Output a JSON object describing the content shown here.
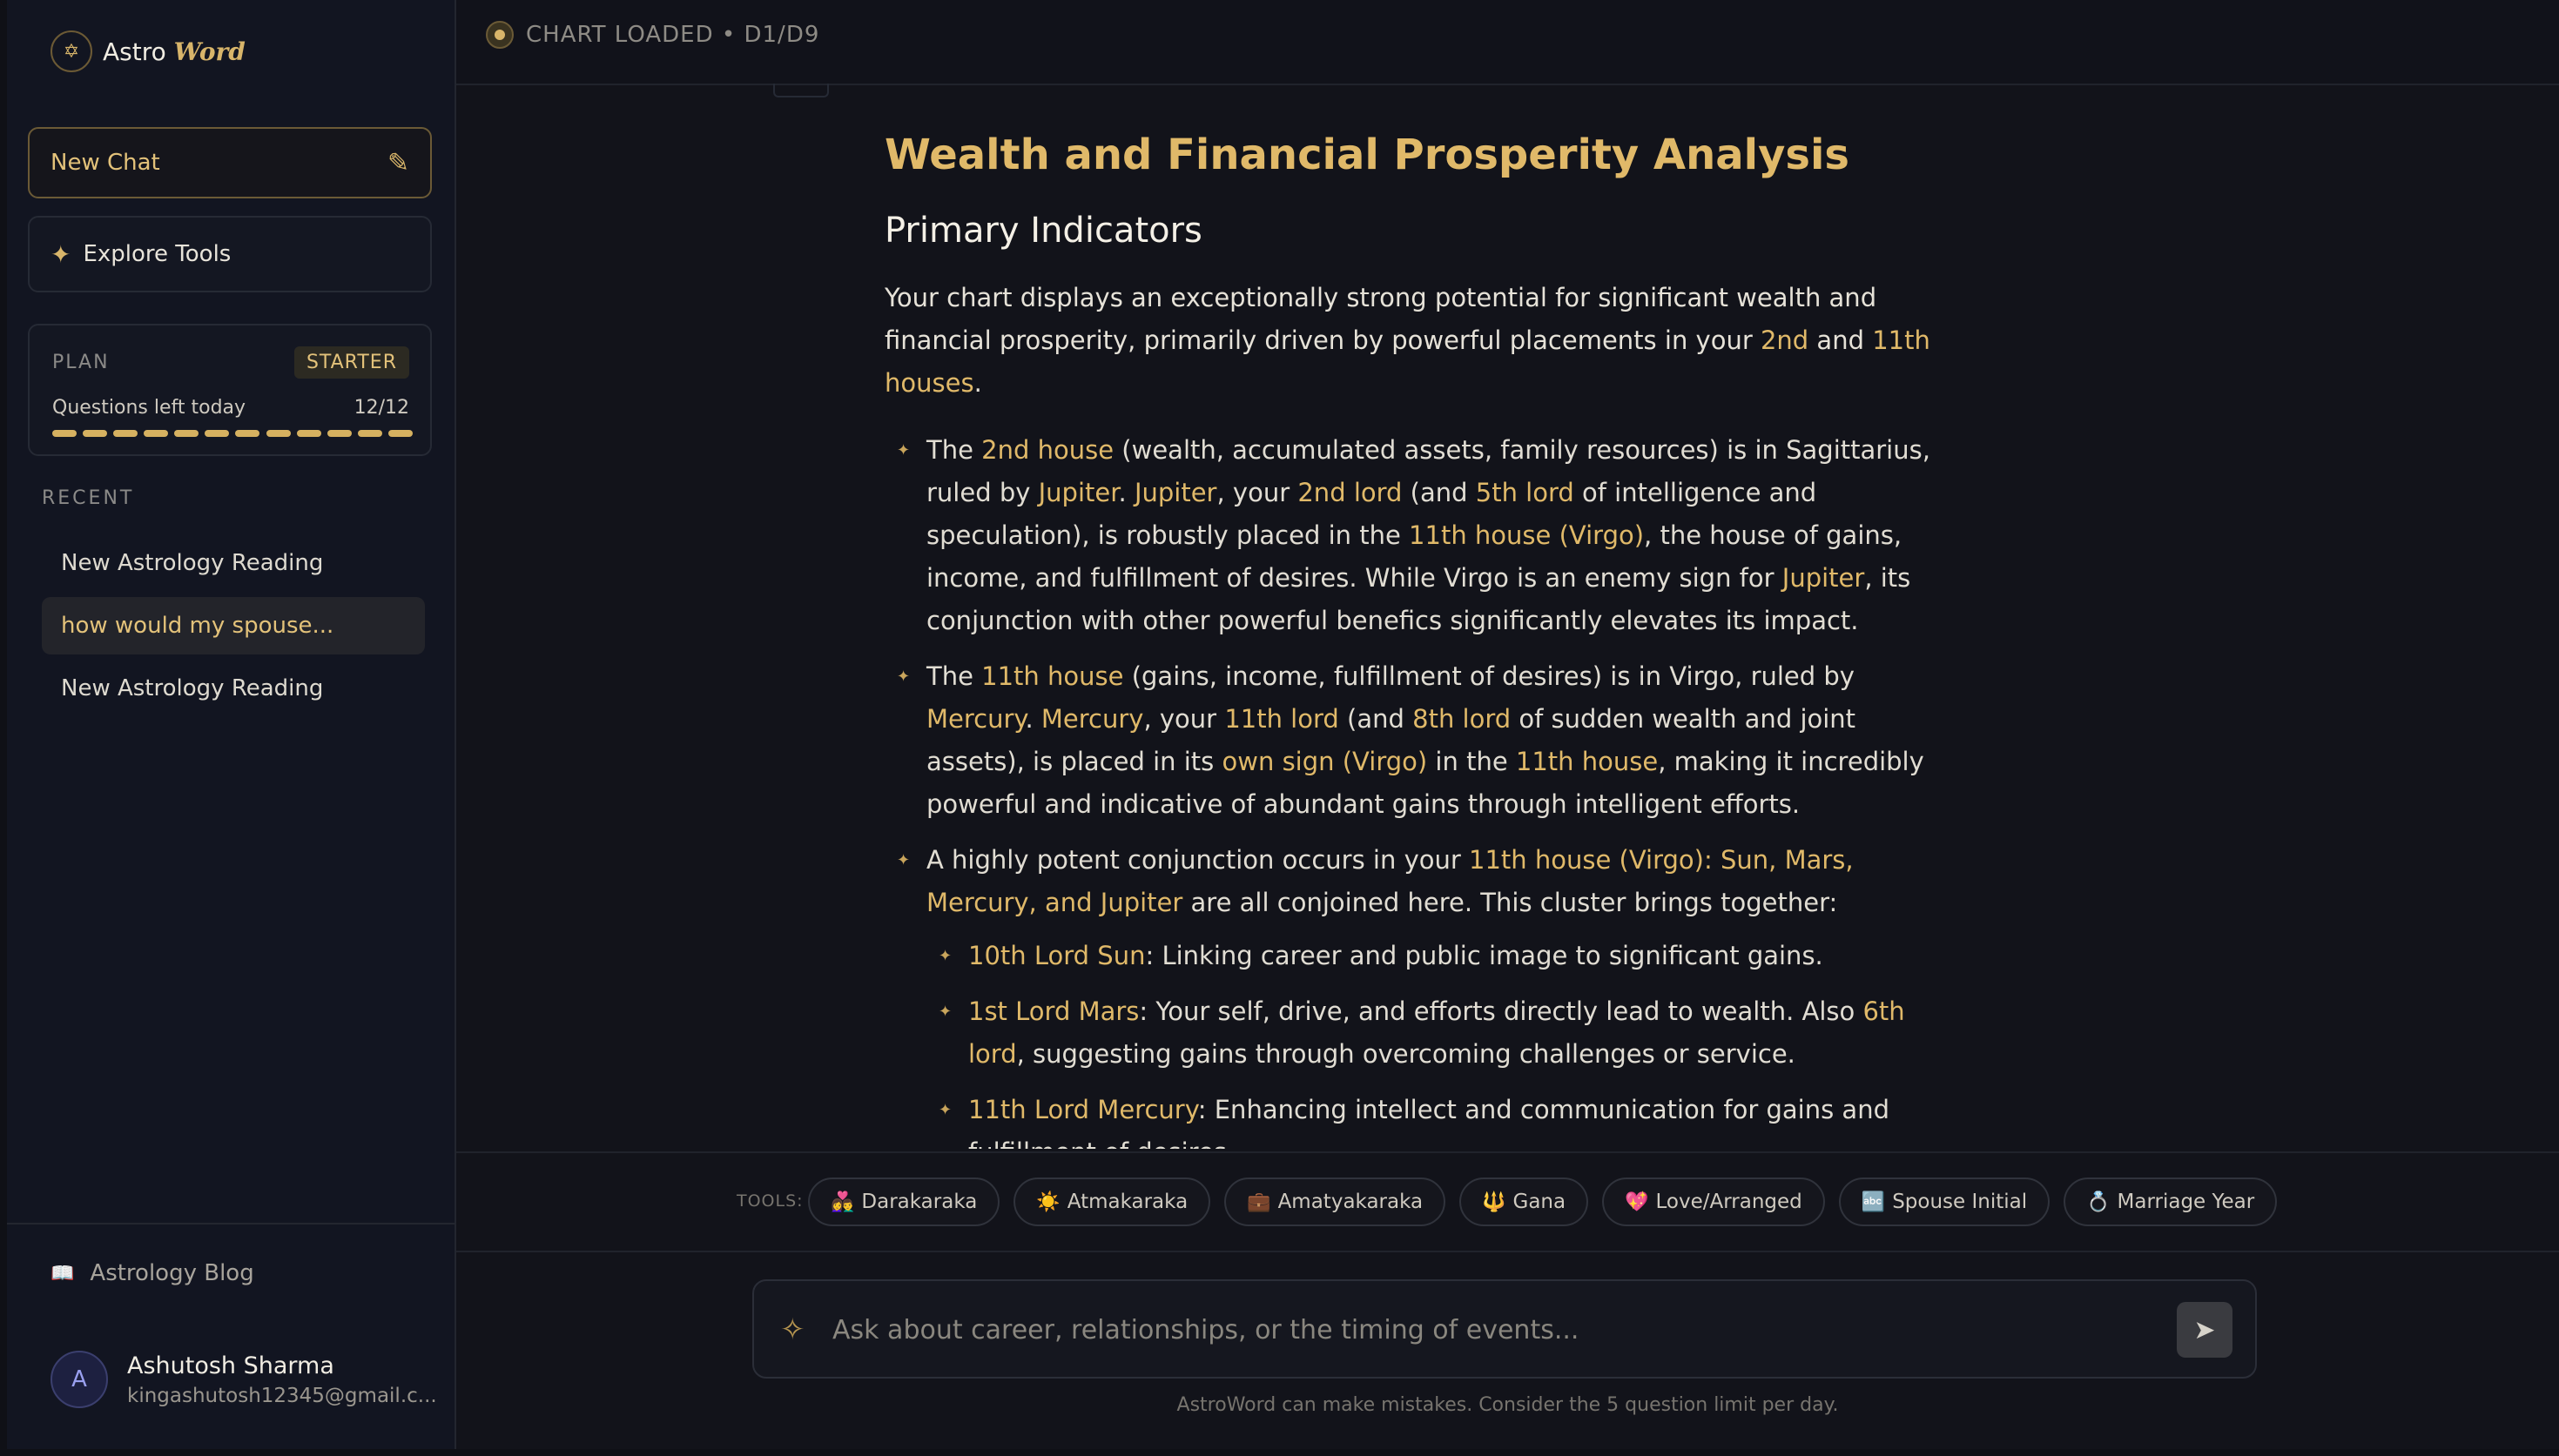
{
  "brand": {
    "prefix": "Astro",
    "suffix": "Word",
    "logo_glyph": "✡"
  },
  "sidebar": {
    "new_chat": "New Chat",
    "explore": "Explore Tools",
    "plan": {
      "label": "PLAN",
      "badge": "STARTER",
      "questions_label": "Questions left today",
      "questions_count": "12/12",
      "questions_fraction": 1.0
    },
    "recent_heading": "RECENT",
    "recent": [
      {
        "label": "New Astrology Reading"
      },
      {
        "label": "how would my spouse..."
      },
      {
        "label": "New Astrology Reading"
      }
    ],
    "blog": "Astrology Blog",
    "user": {
      "initial": "A",
      "name": "Ashutosh Sharma",
      "email": "kingashutosh12345@gmail.c..."
    }
  },
  "header": {
    "status": "CHART LOADED • D1/D9"
  },
  "message": {
    "title": "Wealth and Financial Prosperity Analysis",
    "subtitle": "Primary Indicators",
    "intro": {
      "t1": "Your chart displays an exceptionally strong potential for significant wealth and financial prosperity, primarily driven by powerful placements in your ",
      "h1": "2nd",
      "t2": " and ",
      "h2": "11th houses",
      "t3": "."
    },
    "b1": {
      "t0": "The ",
      "h1": "2nd house",
      "t1": " (wealth, accumulated assets, family resources) is in Sagittarius, ruled by ",
      "h2": "Jupiter",
      "t2": ". ",
      "h3": "Jupiter",
      "t3": ", your ",
      "h4": "2nd lord",
      "t4": " (and ",
      "h5": "5th lord",
      "t5": " of intelligence and speculation), is robustly placed in the ",
      "h6": "11th house (Virgo)",
      "t6": ", the house of gains, income, and fulfillment of desires. While Virgo is an enemy sign for ",
      "h7": "Jupiter",
      "t7": ", its conjunction with other powerful benefics significantly elevates its impact."
    },
    "b2": {
      "t0": "The ",
      "h1": "11th house",
      "t1": " (gains, income, fulfillment of desires) is in Virgo, ruled by ",
      "h2": "Mercury",
      "t2": ". ",
      "h3": "Mercury",
      "t3": ", your ",
      "h4": "11th lord",
      "t4": " (and ",
      "h5": "8th lord",
      "t5": " of sudden wealth and joint assets), is placed in its ",
      "h6": "own sign (Virgo)",
      "t6": " in the ",
      "h7": "11th house",
      "t7": ", making it incredibly powerful and indicative of abundant gains through intelligent efforts."
    },
    "b3": {
      "t0": "A highly potent conjunction occurs in your ",
      "h1": "11th house (Virgo): Sun, Mars, Mercury, and Jupiter",
      "t1": " are all conjoined here. This cluster brings together:"
    },
    "s1": {
      "h1": "10th Lord Sun",
      "t1": ": Linking career and public image to significant gains."
    },
    "s2": {
      "h1": "1st Lord Mars",
      "t1": ": Your self, drive, and efforts directly lead to wealth. Also ",
      "h2": "6th lord",
      "t2": ", suggesting gains through overcoming challenges or service."
    },
    "s3": {
      "h1": "11th Lord Mercury",
      "t1": ": Enhancing intellect and communication for gains and fulfillment of desires."
    }
  },
  "tools": {
    "label": "TOOLS:",
    "chips": [
      {
        "icon": "👩‍❤️‍👨",
        "label": "Darakaraka"
      },
      {
        "icon": "☀️",
        "label": "Atmakaraka"
      },
      {
        "icon": "💼",
        "label": "Amatyakaraka"
      },
      {
        "icon": "🔱",
        "label": "Gana"
      },
      {
        "icon": "💖",
        "label": "Love/Arranged"
      },
      {
        "icon": "🔤",
        "label": "Spouse Initial"
      },
      {
        "icon": "💍",
        "label": "Marriage Year"
      }
    ]
  },
  "composer": {
    "placeholder": "Ask about career, relationships, or the timing of events..."
  },
  "disclaimer": "AstroWord can make mistakes. Consider the 5 question limit per day.",
  "colors": {
    "accent": "#e0b969",
    "background": "#12131a",
    "sidebar": "#121521"
  }
}
